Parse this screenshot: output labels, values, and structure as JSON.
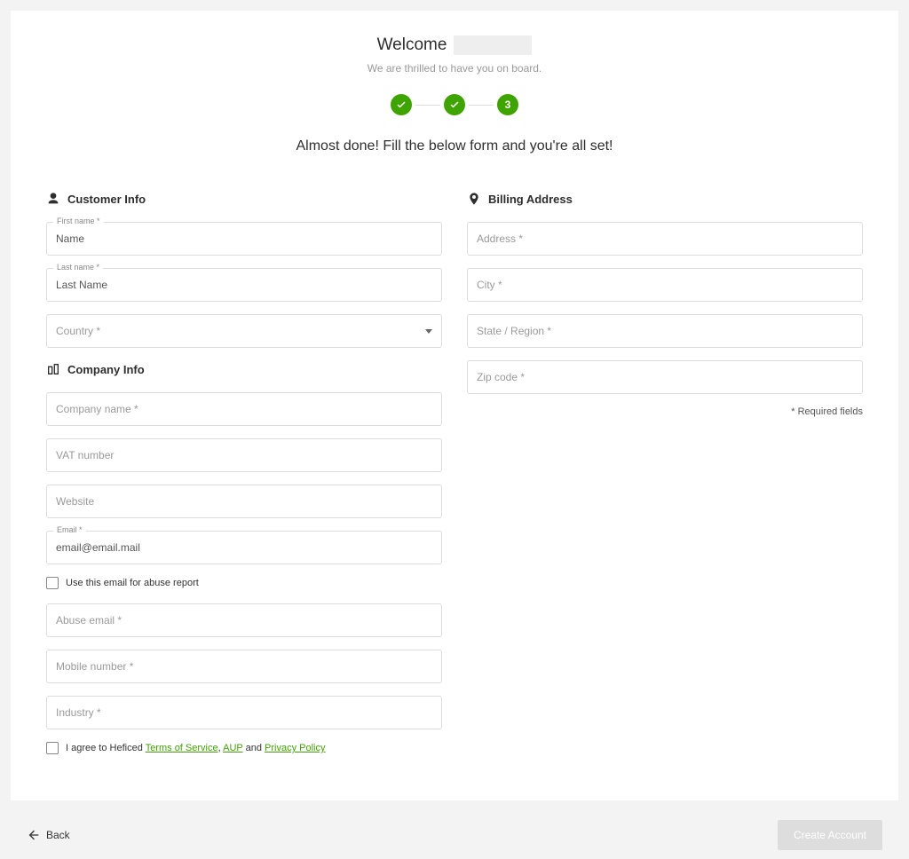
{
  "header": {
    "welcome": "Welcome",
    "subline": "We are thrilled to have you on board.",
    "almost": "Almost done! Fill the below form and you're all set!",
    "step3": "3"
  },
  "sections": {
    "customer": "Customer Info",
    "company": "Company Info",
    "billing": "Billing Address"
  },
  "customer": {
    "first_label": "First name *",
    "first_value": "Name",
    "last_label": "Last name *",
    "last_value": "Last Name",
    "country_placeholder": "Country *"
  },
  "company": {
    "name_placeholder": "Company name *",
    "vat_placeholder": "VAT number",
    "website_placeholder": "Website",
    "email_label": "Email *",
    "email_value": "email@email.mail",
    "abuse_checkbox": "Use this email for abuse report",
    "abuse_placeholder": "Abuse email *",
    "mobile_placeholder": "Mobile number *",
    "industry_placeholder": "Industry *"
  },
  "billing": {
    "address_placeholder": "Address *",
    "city_placeholder": "City *",
    "state_placeholder": "State / Region *",
    "zip_placeholder": "Zip code *",
    "required_note": "* Required fields"
  },
  "agree": {
    "prefix": "I agree to Heficed ",
    "tos": "Terms of Service",
    "sep1": ", ",
    "aup": "AUP",
    "sep2": " and ",
    "pp": "Privacy Policy"
  },
  "footer": {
    "back": "Back",
    "create": "Create Account"
  }
}
